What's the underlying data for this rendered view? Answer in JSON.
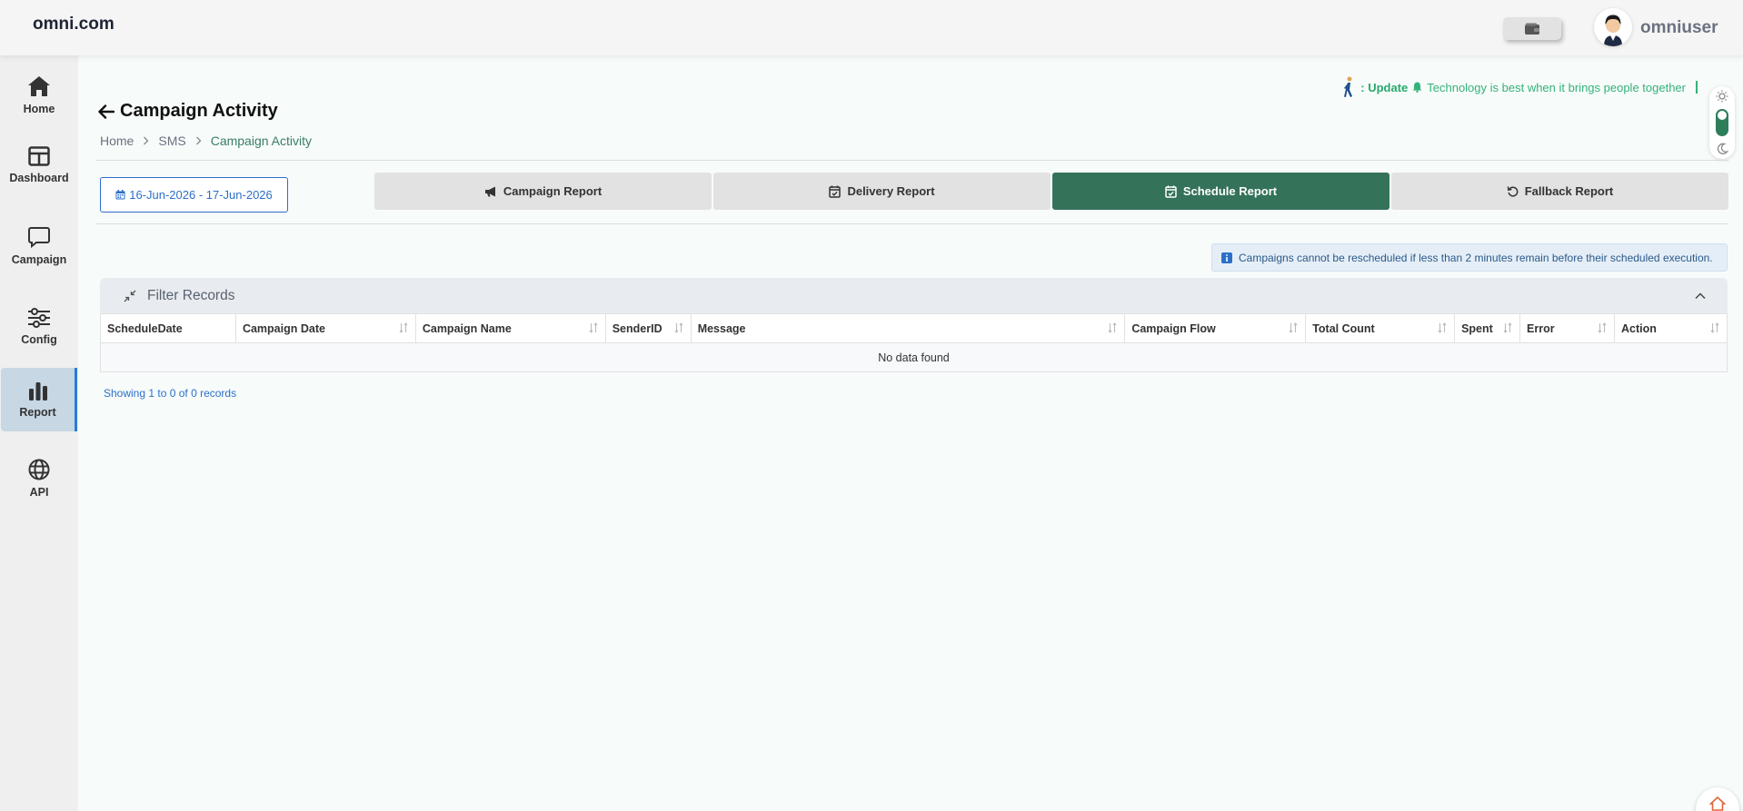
{
  "header": {
    "brand": "omni.com",
    "username": "omniuser"
  },
  "sidebar": {
    "items": [
      {
        "label": "Home",
        "icon": "home-icon"
      },
      {
        "label": "Dashboard",
        "icon": "dashboard-icon"
      },
      {
        "label": "Campaign",
        "icon": "chat-icon"
      },
      {
        "label": "Config",
        "icon": "sliders-icon"
      },
      {
        "label": "Report",
        "icon": "bar-chart-icon",
        "active": true
      },
      {
        "label": "API",
        "icon": "globe-icon"
      }
    ]
  },
  "announcement": {
    "prefix": ": Update",
    "text": "Technology is best when it brings people together"
  },
  "page": {
    "title": "Campaign Activity",
    "breadcrumb": [
      "Home",
      "SMS",
      "Campaign Activity"
    ]
  },
  "date_range": "16-Jun-2026 - 17-Jun-2026",
  "tabs": [
    {
      "label": "Campaign Report",
      "icon": "megaphone-icon"
    },
    {
      "label": "Delivery Report",
      "icon": "calendar-check-icon"
    },
    {
      "label": "Schedule Report",
      "icon": "calendar-check-icon",
      "active": true
    },
    {
      "label": "Fallback Report",
      "icon": "undo-icon"
    }
  ],
  "info_note": "Campaigns cannot be rescheduled if less than 2 minutes remain before their scheduled execution.",
  "filter": {
    "title": "Filter Records"
  },
  "table": {
    "columns": [
      "ScheduleDate",
      "Campaign Date",
      "Campaign Name",
      "SenderID",
      "Message",
      "Campaign Flow",
      "Total Count",
      "Spent",
      "Error",
      "Action"
    ],
    "empty_text": "No data found"
  },
  "records_text": "Showing 1 to 0 of 0 records",
  "colors": {
    "primary": "#347259",
    "accent_blue": "#2c6fc9",
    "announce_green": "#34b27b"
  }
}
